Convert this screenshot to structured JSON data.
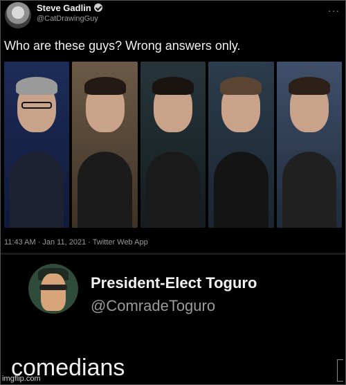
{
  "top_tweet": {
    "author_name": "Steve Gadlin",
    "author_handle": "@CatDrawingGuy",
    "text": "Who are these guys? Wrong answers only.",
    "timestamp": "11:43 AM · Jan 11, 2021 · Twitter Web App",
    "more_icon": "···",
    "photos": [
      "person-1",
      "person-2",
      "person-3",
      "person-4",
      "person-5"
    ]
  },
  "reply_tweet": {
    "author_name": "President-Elect Toguro",
    "author_handle": "@ComradeToguro",
    "text": "comedians"
  },
  "watermark": "imgflip.com"
}
